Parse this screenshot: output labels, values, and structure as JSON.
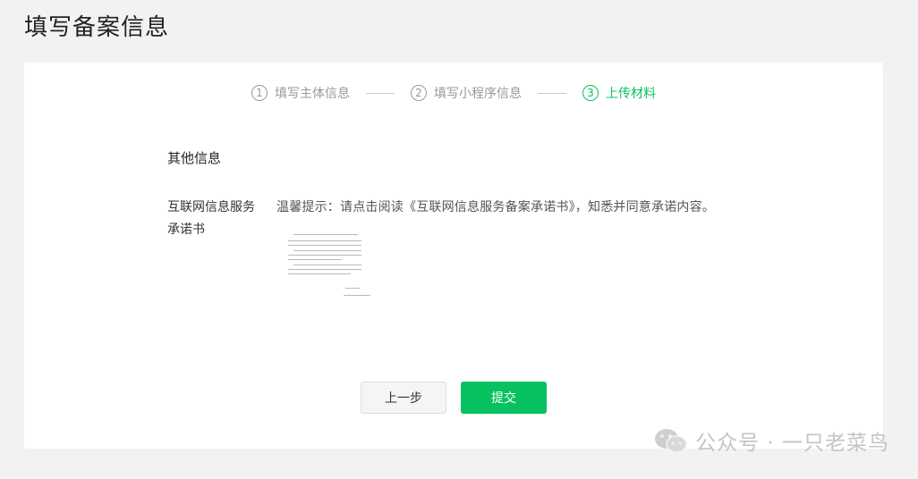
{
  "page": {
    "title": "填写备案信息"
  },
  "steps": [
    {
      "num": "1",
      "label": "填写主体信息",
      "state": "done"
    },
    {
      "num": "2",
      "label": "填写小程序信息",
      "state": "done"
    },
    {
      "num": "3",
      "label": "上传材料",
      "state": "active"
    }
  ],
  "section": {
    "title": "其他信息"
  },
  "commitment": {
    "label": "互联网信息服务承诺书",
    "tip": "温馨提示：请点击阅读《互联网信息服务备案承诺书》，知悉并同意承诺内容。"
  },
  "buttons": {
    "prev": "上一步",
    "submit": "提交"
  },
  "watermark": {
    "text": "公众号 · 一只老菜鸟",
    "icon": "wechat-icon"
  },
  "colors": {
    "accent": "#07c160",
    "background": "#f2f2f2"
  }
}
